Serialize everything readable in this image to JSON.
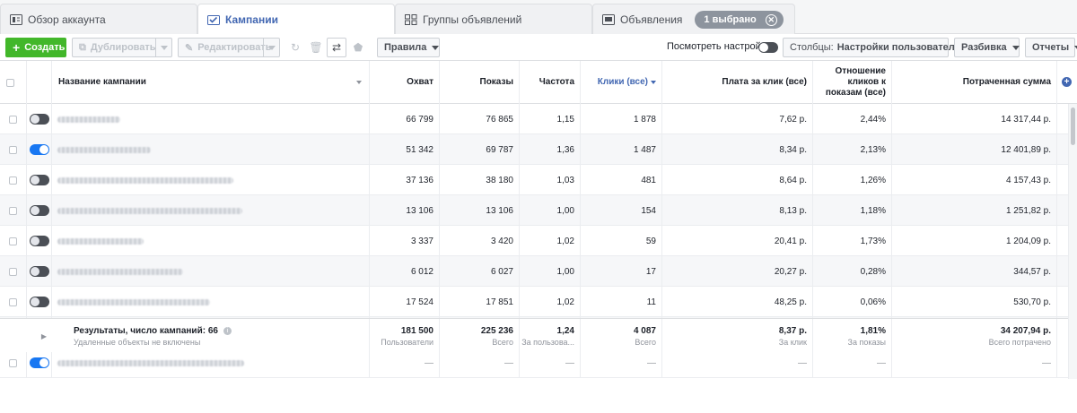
{
  "tabs": [
    {
      "label": "Обзор аккаунта",
      "icon": "overview-icon"
    },
    {
      "label": "Кампании",
      "icon": "campaign-icon"
    },
    {
      "label": "Группы объявлений",
      "icon": "grid-icon"
    },
    {
      "label": "Объявления",
      "icon": "ad-icon"
    }
  ],
  "selected_pill": "1 выбрано",
  "toolbar": {
    "create": "Создать",
    "duplicate": "Дублировать",
    "edit": "Редактировать",
    "rules": "Правила",
    "view_settings": "Посмотреть настройки",
    "columns_prefix": "Столбцы:",
    "columns_value": "Настройки пользователя",
    "breakdown": "Разбивка",
    "reports": "Отчеты"
  },
  "columns": {
    "name": "Название кампании",
    "reach": "Охват",
    "impressions": "Показы",
    "frequency": "Частота",
    "clicks": "Клики (все)",
    "cpc": "Плата за клик (все)",
    "ctr": "Отношение кликов к показам (все)",
    "spent": "Потраченная сумма"
  },
  "rows": [
    {
      "on": false,
      "reach": "66 799",
      "impressions": "76 865",
      "frequency": "1,15",
      "clicks": "1 878",
      "cpc": "7,62 р.",
      "ctr": "2,44%",
      "spent": "14 317,44 р."
    },
    {
      "on": true,
      "reach": "51 342",
      "impressions": "69 787",
      "frequency": "1,36",
      "clicks": "1 487",
      "cpc": "8,34 р.",
      "ctr": "2,13%",
      "spent": "12 401,89 р."
    },
    {
      "on": false,
      "reach": "37 136",
      "impressions": "38 180",
      "frequency": "1,03",
      "clicks": "481",
      "cpc": "8,64 р.",
      "ctr": "1,26%",
      "spent": "4 157,43 р."
    },
    {
      "on": false,
      "reach": "13 106",
      "impressions": "13 106",
      "frequency": "1,00",
      "clicks": "154",
      "cpc": "8,13 р.",
      "ctr": "1,18%",
      "spent": "1 251,82 р."
    },
    {
      "on": false,
      "reach": "3 337",
      "impressions": "3 420",
      "frequency": "1,02",
      "clicks": "59",
      "cpc": "20,41 р.",
      "ctr": "1,73%",
      "spent": "1 204,09 р."
    },
    {
      "on": false,
      "reach": "6 012",
      "impressions": "6 027",
      "frequency": "1,00",
      "clicks": "17",
      "cpc": "20,27 р.",
      "ctr": "0,28%",
      "spent": "344,57 р."
    },
    {
      "on": false,
      "reach": "17 524",
      "impressions": "17 851",
      "frequency": "1,02",
      "clicks": "11",
      "cpc": "48,25 р.",
      "ctr": "0,06%",
      "spent": "530,70 р."
    },
    {
      "on": true,
      "reach": "—",
      "impressions": "—",
      "frequency": "—",
      "clicks": "—",
      "cpc": "—",
      "ctr": "—",
      "spent": "—"
    },
    {
      "on": true,
      "reach": "—",
      "impressions": "—",
      "frequency": "—",
      "clicks": "—",
      "cpc": "—",
      "ctr": "—",
      "spent": "—"
    }
  ],
  "totals": {
    "label": "Результаты, число кампаний: 66",
    "note": "Удаленные объекты не включены",
    "reach": "181 500",
    "reach_sub": "Пользователи",
    "impressions": "225 236",
    "impressions_sub": "Всего",
    "frequency": "1,24",
    "frequency_sub": "За пользова...",
    "clicks": "4 087",
    "clicks_sub": "Всего",
    "cpc": "8,37 р.",
    "cpc_sub": "За клик",
    "ctr": "1,81%",
    "ctr_sub": "За показы",
    "spent": "34 207,94 р.",
    "spent_sub": "Всего потрачено"
  },
  "colors": {
    "accent": "#4267b2",
    "create": "#42b72a",
    "toggle_on": "#1877f2"
  }
}
